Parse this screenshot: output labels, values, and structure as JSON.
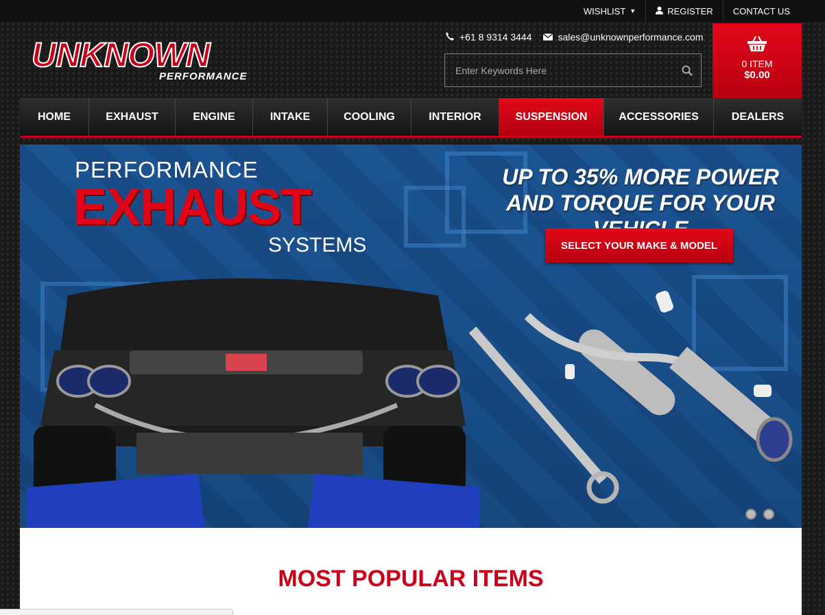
{
  "topbar": {
    "wishlist": "WISHLIST",
    "register": "REGISTER",
    "contact": "CONTACT US"
  },
  "logo": {
    "main": "UNKNOWN",
    "sub": "PERFORMANCE"
  },
  "header": {
    "phone": "+61 8 9314 3444",
    "email": "sales@unknownperformance.com",
    "search_placeholder": "Enter Keywords Here"
  },
  "cart": {
    "items": "0 ITEM",
    "total": "$0.00"
  },
  "nav": {
    "items": [
      {
        "label": "HOME"
      },
      {
        "label": "EXHAUST"
      },
      {
        "label": "ENGINE"
      },
      {
        "label": "INTAKE"
      },
      {
        "label": "COOLING"
      },
      {
        "label": "INTERIOR"
      },
      {
        "label": "SUSPENSION"
      },
      {
        "label": "ACCESSORIES"
      },
      {
        "label": "DEALERS"
      }
    ],
    "active": "SUSPENSION"
  },
  "banner": {
    "performance": "PERFORMANCE",
    "exhaust": "EXHAUST",
    "systems": "SYSTEMS",
    "tagline1": "UP TO 35% MORE POWER",
    "tagline2": "AND TORQUE FOR YOUR VEHICLE",
    "cta": "SELECT YOUR MAKE & MODEL",
    "slide_count": 2
  },
  "content": {
    "heading": "MOST POPULAR ITEMS"
  },
  "colors": {
    "accent": "#c8001a",
    "banner_blue": "#1e63a6"
  }
}
